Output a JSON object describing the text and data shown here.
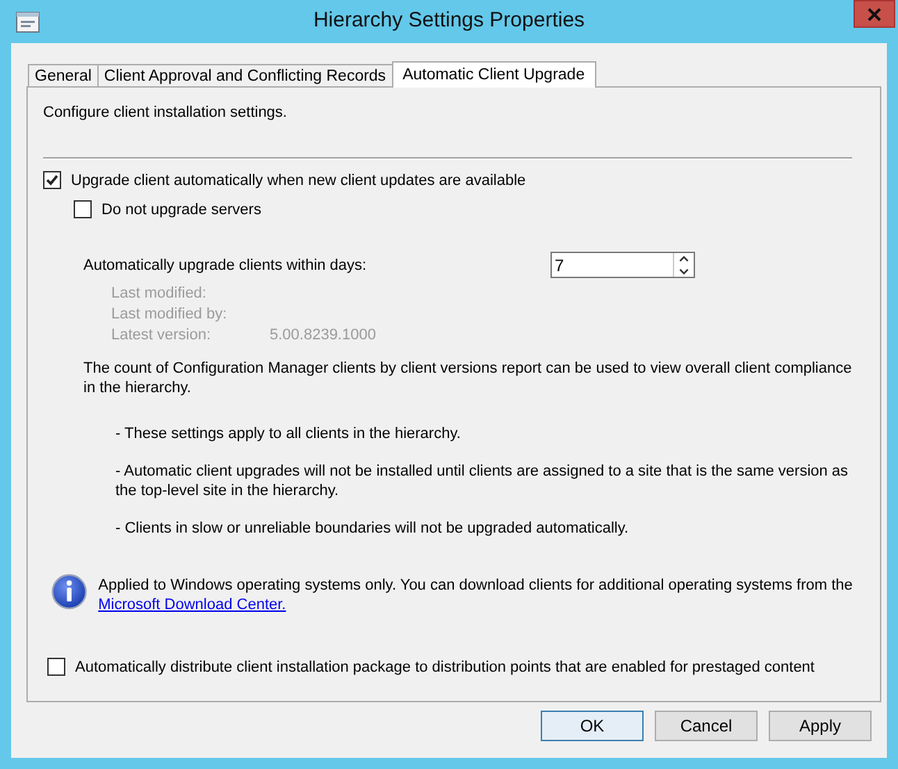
{
  "window": {
    "title": "Hierarchy Settings Properties"
  },
  "tabs": [
    {
      "label": "General",
      "selected": false
    },
    {
      "label": "Client Approval and Conflicting Records",
      "selected": false
    },
    {
      "label": "Automatic Client Upgrade",
      "selected": true
    }
  ],
  "panel": {
    "intro": "Configure client installation settings.",
    "options": [
      {
        "label": "Upgrade client automatically when new client updates are available",
        "checked": true,
        "children": [
          {
            "label": "Do not upgrade servers",
            "checked": false
          }
        ]
      }
    ],
    "days": {
      "label": "Automatically upgrade clients within days:",
      "value": "7"
    },
    "details": [
      {
        "label": "Last modified:"
      },
      {
        "label": "Last modified by:"
      },
      {
        "label": "Latest version:",
        "value": "5.00.8239.1000"
      }
    ],
    "report_note": "The count of Configuration Manager clients by client versions report can be used to view overall client compliance in the hierarchy.",
    "notes": [
      "- These settings apply to all clients in the hierarchy.",
      "- Automatic client upgrades will not be installed until clients are assigned to a site that is the same version as the top-level site in the hierarchy.",
      "- Clients in slow or unreliable boundaries will not be upgraded automatically."
    ],
    "info": {
      "text": "Applied to Windows operating systems only. You can download clients for additional operating systems from the",
      "link": "Microsoft Download Center."
    },
    "prestage_option": {
      "label": "Automatically distribute client installation package to distribution points that are enabled for prestaged content",
      "checked": false
    }
  },
  "buttons": [
    {
      "label": "OK",
      "default": true
    },
    {
      "label": "Cancel",
      "default": false
    },
    {
      "label": "Apply",
      "default": false
    }
  ]
}
